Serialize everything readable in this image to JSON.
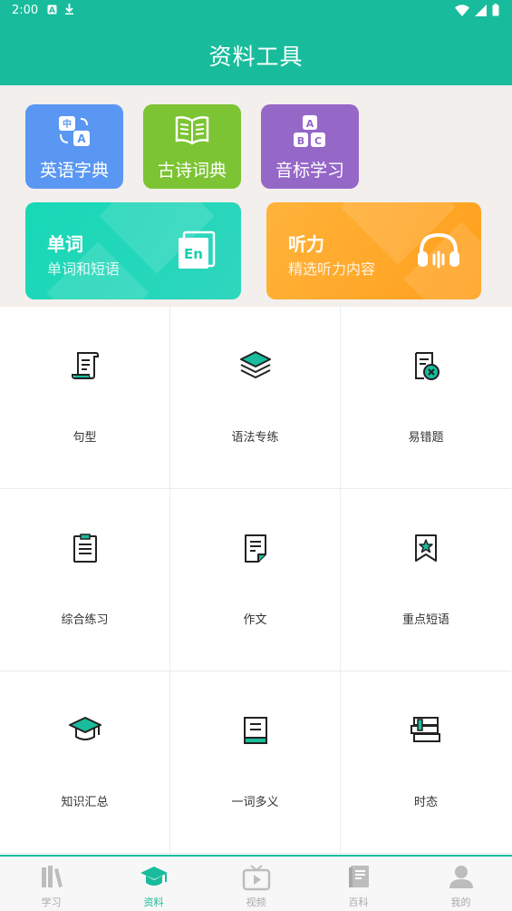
{
  "status_bar": {
    "time": "2:00",
    "left_icons": [
      "a-badge-icon",
      "download-icon"
    ],
    "right_icons": [
      "wifi-icon",
      "signal-icon",
      "battery-icon"
    ]
  },
  "header": {
    "title": "资料工具"
  },
  "tools": {
    "small_tiles": [
      {
        "label": "英语字典",
        "icon": "translate-icon",
        "color": "#5a97f2"
      },
      {
        "label": "古诗词典",
        "icon": "open-book-icon",
        "color": "#7cc433"
      },
      {
        "label": "音标学习",
        "icon": "abc-blocks-icon",
        "color": "#9567c7"
      }
    ],
    "large_tiles": [
      {
        "title": "单词",
        "subtitle": "单词和短语",
        "icon": "en-card-icon",
        "color": "#17d8b6"
      },
      {
        "title": "听力",
        "subtitle": "精选听力内容",
        "icon": "headphones-icon",
        "color": "#ffa726"
      }
    ]
  },
  "grid": {
    "items": [
      {
        "label": "句型",
        "icon": "scroll-icon"
      },
      {
        "label": "语法专练",
        "icon": "layers-icon"
      },
      {
        "label": "易错题",
        "icon": "wrong-question-icon"
      },
      {
        "label": "综合练习",
        "icon": "clipboard-icon"
      },
      {
        "label": "作文",
        "icon": "document-icon"
      },
      {
        "label": "重点短语",
        "icon": "star-bookmark-icon"
      },
      {
        "label": "知识汇总",
        "icon": "graduation-cap-icon"
      },
      {
        "label": "一词多义",
        "icon": "book-icon"
      },
      {
        "label": "时态",
        "icon": "book-stack-icon"
      }
    ]
  },
  "bottom_nav": {
    "active_index": 1,
    "items": [
      {
        "label": "学习",
        "icon": "books-icon"
      },
      {
        "label": "资料",
        "icon": "graduation-cap-icon"
      },
      {
        "label": "视频",
        "icon": "tv-play-icon"
      },
      {
        "label": "百科",
        "icon": "encyclopedia-icon"
      },
      {
        "label": "我的",
        "icon": "person-icon"
      }
    ]
  },
  "colors": {
    "primary": "#18bc9c",
    "tools_background": "#f2efec",
    "nav_inactive": "#aaaaaa"
  }
}
